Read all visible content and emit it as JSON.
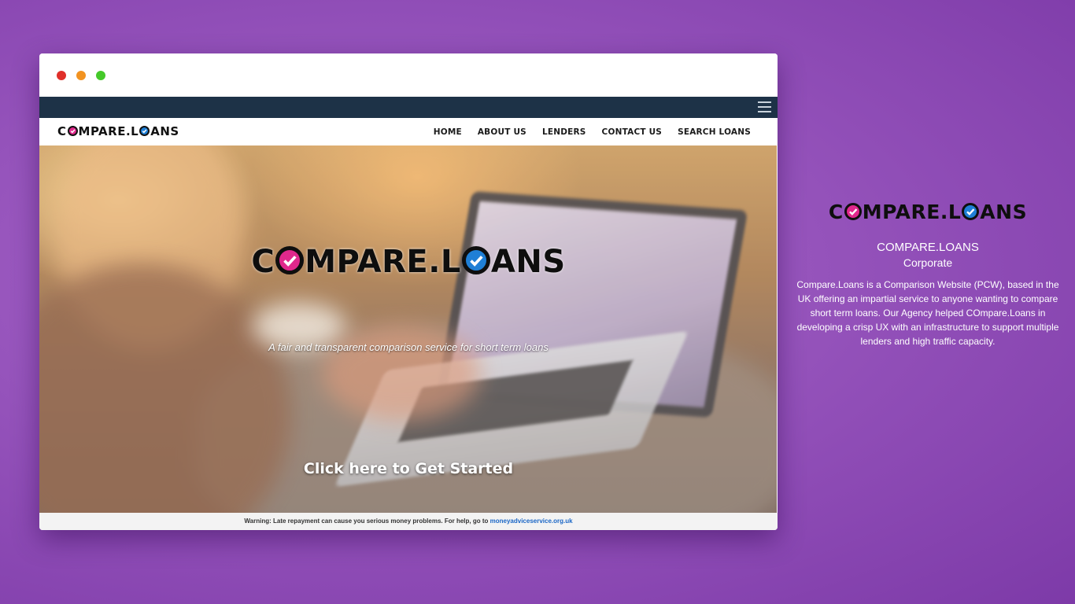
{
  "colors": {
    "background": "#9553bb",
    "brand_magenta": "#e0288c",
    "brand_blue": "#1f7fd6",
    "topbar": "#1d3247",
    "link": "#1a66c6"
  },
  "browser": {
    "window_controls": [
      "close",
      "minimize",
      "maximize"
    ],
    "menu_icon": "hamburger-icon"
  },
  "site": {
    "logo": {
      "part1": "C",
      "part2": "MPARE.L",
      "part3": "ANS"
    },
    "nav": [
      {
        "label": "HOME"
      },
      {
        "label": "ABOUT US"
      },
      {
        "label": "LENDERS"
      },
      {
        "label": "CONTACT US"
      },
      {
        "label": "SEARCH LOANS"
      }
    ],
    "hero": {
      "tagline": "A fair and transparent comparison service for short term loans",
      "cta": "Click here to Get Started"
    },
    "warning": {
      "text": "Warning: Late repayment can cause you serious money problems. For help, go to ",
      "link": "moneyadviceservice.org.uk"
    }
  },
  "project": {
    "name": "COMPARE.LOANS",
    "category": "Corporate",
    "description": "Compare.Loans is a Comparison Website (PCW), based in the UK offering an impartial service to anyone wanting to compare short term loans. Our Agency helped COmpare.Loans in developing a crisp UX with an infrastructure to support multiple lenders and high traffic capacity."
  }
}
